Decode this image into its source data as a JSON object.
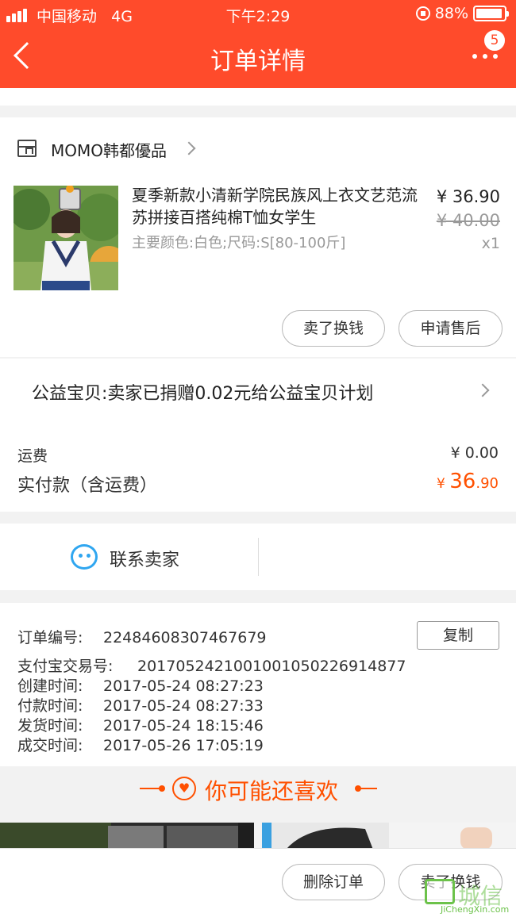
{
  "status_bar": {
    "carrier": "中国移动",
    "network": "4G",
    "time": "下午2:29",
    "battery": "88%"
  },
  "header": {
    "title": "订单详情",
    "badge_count": "5"
  },
  "shop": {
    "name": "MOMO韩都優品"
  },
  "product": {
    "title": "夏季新款小清新学院民族风上衣文艺范流苏拼接百搭纯棉T恤女学生",
    "sku": "主要颜色:白色;尺码:S[80-100斤]",
    "price": "¥ 36.90",
    "original_price": "¥ 40.00",
    "quantity": "x1"
  },
  "item_actions": {
    "sell_label": "卖了换钱",
    "after_sale_label": "申请售后"
  },
  "charity": {
    "text": "公益宝贝:卖家已捐赠0.02元给公益宝贝计划"
  },
  "totals": {
    "shipping_label": "运费",
    "shipping_value": "¥ 0.00",
    "paid_label": "实付款（含运费）",
    "paid_currency": "¥ ",
    "paid_integer": "36",
    "paid_decimal": ".90"
  },
  "contact": {
    "label": "联系卖家"
  },
  "order_info": {
    "order_no_label": "订单编号:",
    "order_no": "2248460830746767​9",
    "copy_label": "复制",
    "alipay_label": "支付宝交易号:",
    "alipay_no": "2017052421001001050226914877",
    "created_label": "创建时间:",
    "created": "2017-05-24 08:27:23",
    "paid_label": "付款时间:",
    "paid": "2017-05-24 08:27:33",
    "shipped_label": "发货时间:",
    "shipped": "2017-05-24 18:15:46",
    "completed_label": "成交时间:",
    "completed": "2017-05-26 17:05:19"
  },
  "recommend": {
    "title": "你可能还喜欢"
  },
  "bottom_bar": {
    "delete_label": "删除订单",
    "sell_label": "卖了换钱"
  },
  "watermark": {
    "text": "城信",
    "sub": "JiChengXin.com"
  },
  "colors": {
    "brand": "#ff4b2b",
    "price_accent": "#ff5000",
    "contact_icon": "#2fa6f0"
  }
}
